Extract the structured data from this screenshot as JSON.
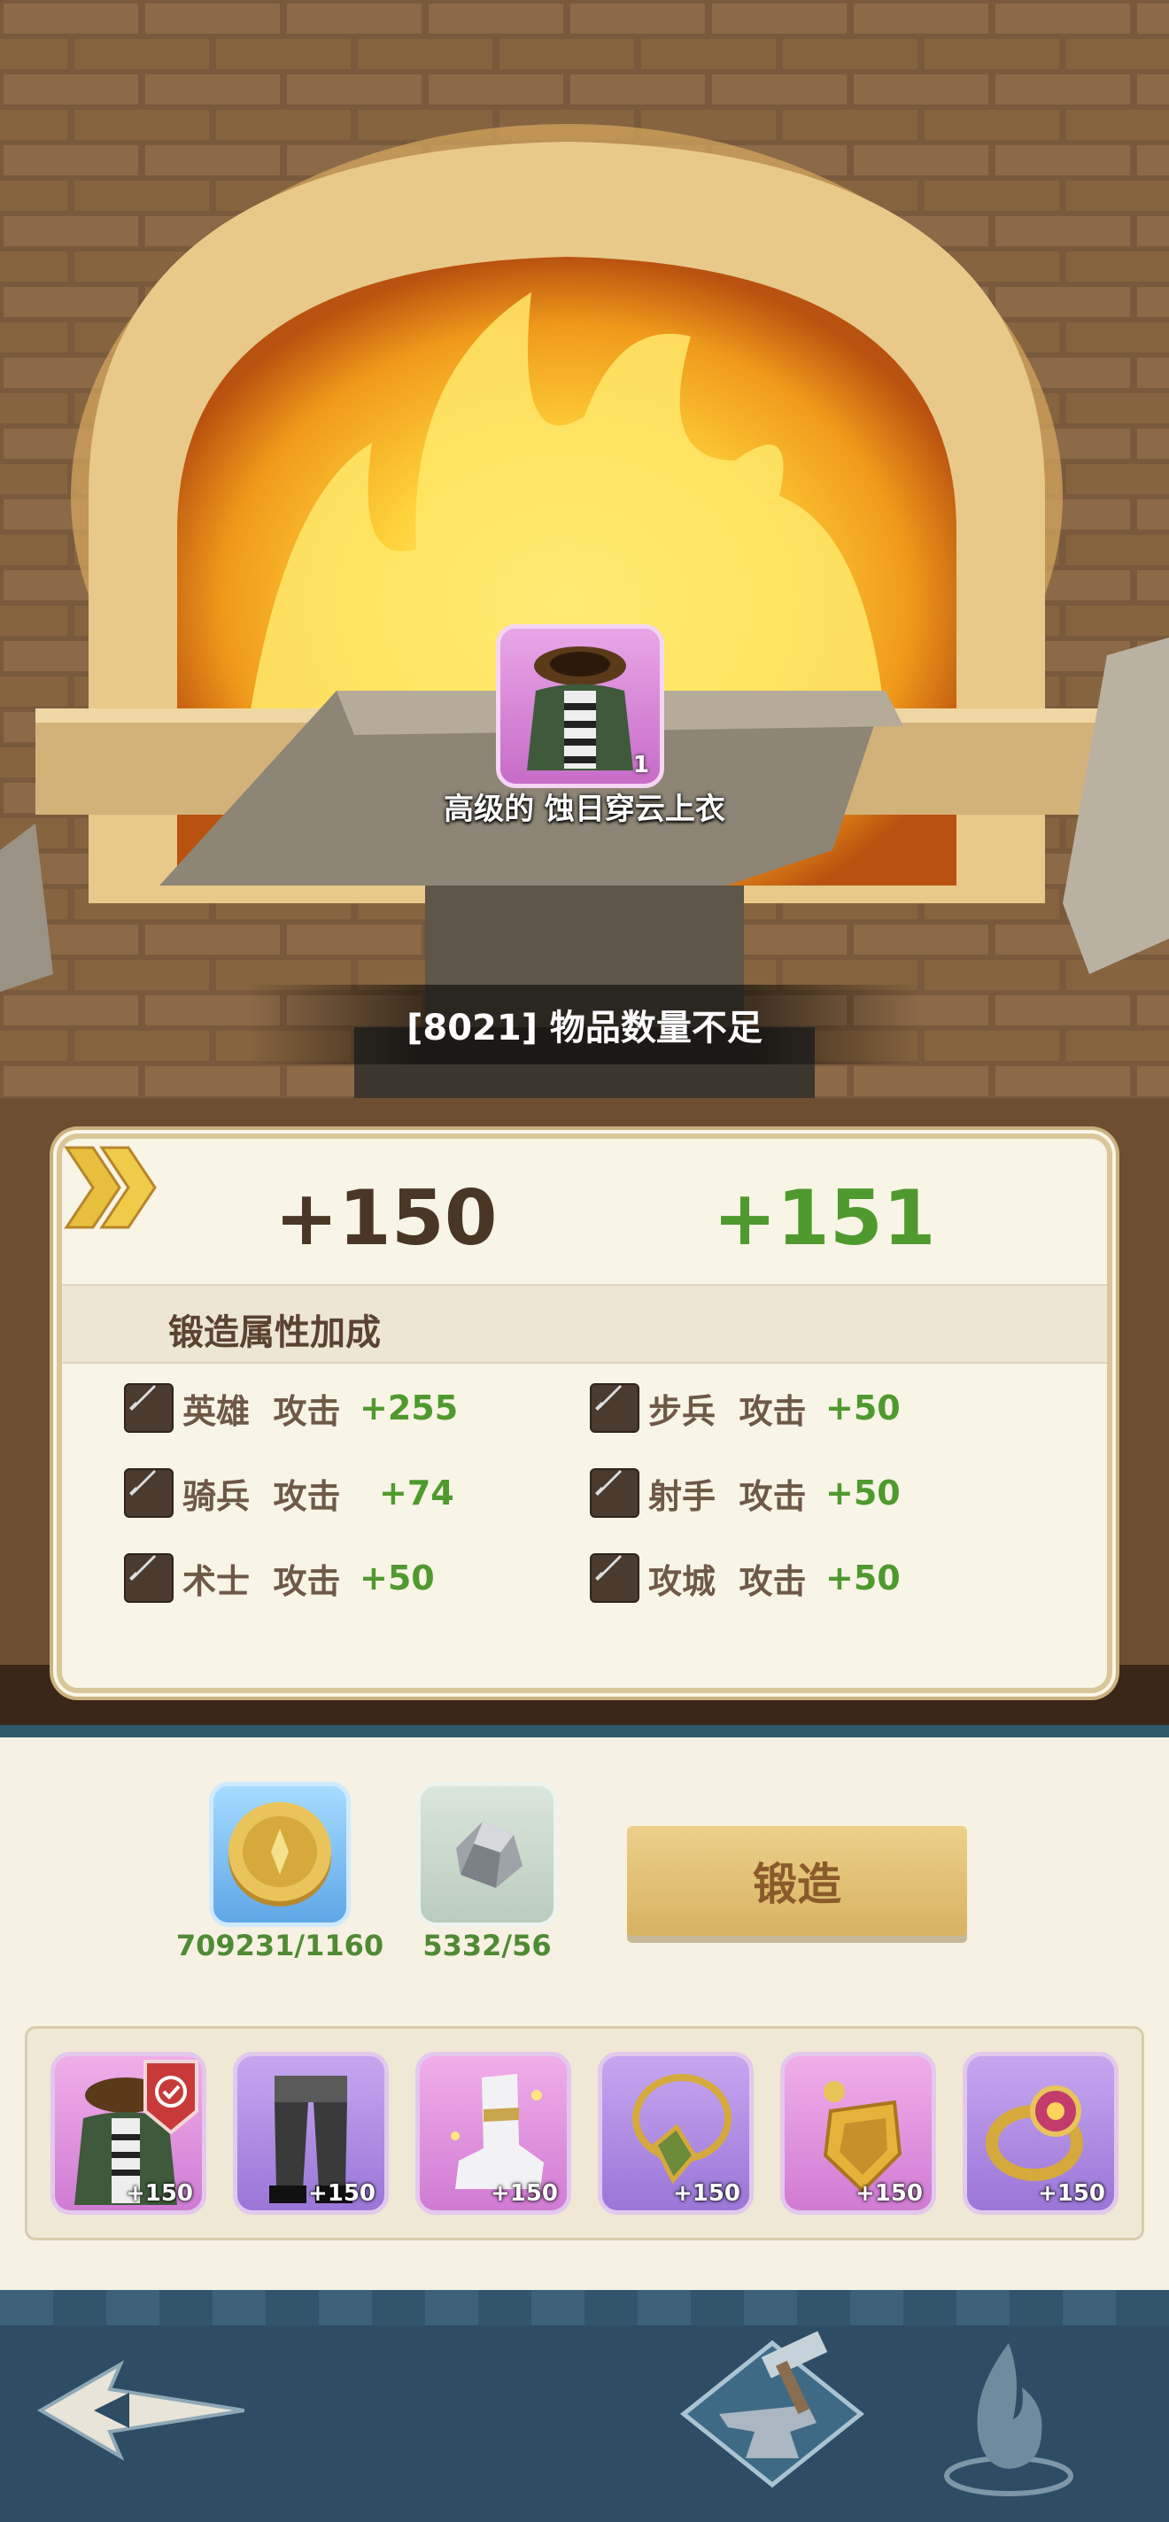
{
  "item": {
    "name": "高级的 蚀日穿云上衣",
    "quantity": "1"
  },
  "toast": "[8021] 物品数量不足",
  "forge_panel": {
    "current_level": "+150",
    "next_level": "+151",
    "section_title": "锻造属性加成",
    "stats": [
      {
        "unit": "英雄",
        "type": "攻击",
        "value": "+255"
      },
      {
        "unit": "步兵",
        "type": "攻击",
        "value": "+50"
      },
      {
        "unit": "骑兵",
        "type": "攻击",
        "value": "+74"
      },
      {
        "unit": "射手",
        "type": "攻击",
        "value": "+50"
      },
      {
        "unit": "术士",
        "type": "攻击",
        "value": "+50"
      },
      {
        "unit": "攻城",
        "type": "攻击",
        "value": "+50"
      }
    ]
  },
  "resources": [
    {
      "name": "gold-coin-icon",
      "amount": "709231/1160"
    },
    {
      "name": "ore-icon",
      "amount": "5332/56"
    }
  ],
  "forge_button": "锻造",
  "equipment": [
    {
      "icon": "coat-icon",
      "level": "+150",
      "color": "pink",
      "selected": true
    },
    {
      "icon": "pants-icon",
      "level": "+150",
      "color": "purple"
    },
    {
      "icon": "boots-icon",
      "level": "+150",
      "color": "pink"
    },
    {
      "icon": "necklace-icon",
      "level": "+150",
      "color": "purple"
    },
    {
      "icon": "shield-icon",
      "level": "+150",
      "color": "pink"
    },
    {
      "icon": "ring-icon",
      "level": "+150",
      "color": "purple"
    }
  ],
  "nav": [
    "back-icon",
    "anvil-icon",
    "flame-icon"
  ],
  "colors": {
    "gain": "#4f9a2e",
    "panel_bg": "#f8f4e6",
    "nav_bg": "#2e4c63"
  }
}
